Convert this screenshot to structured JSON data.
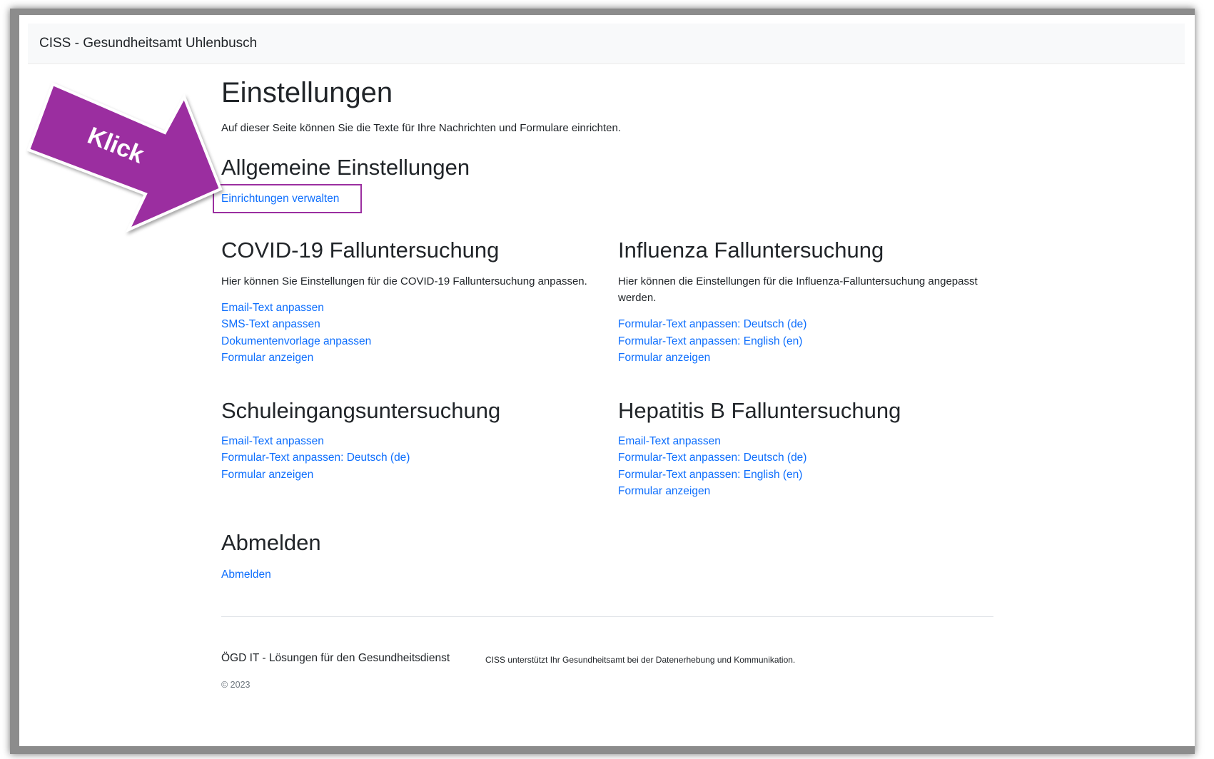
{
  "app": {
    "brand": "CISS - Gesundheitsamt Uhlenbusch"
  },
  "page": {
    "title": "Einstellungen",
    "intro": "Auf dieser Seite können Sie die Texte für Ihre Nachrichten und Formulare einrichten."
  },
  "general": {
    "heading": "Allgemeine Einstellungen",
    "link": "Einrichtungen verwalten"
  },
  "covid": {
    "heading": "COVID-19 Falluntersuchung",
    "description": "Hier können Sie Einstellungen für die COVID-19 Falluntersuchung anpassen.",
    "links": [
      "Email-Text anpassen",
      "SMS-Text anpassen",
      "Dokumentenvorlage anpassen",
      "Formular anzeigen"
    ]
  },
  "influenza": {
    "heading": "Influenza Falluntersuchung",
    "description": "Hier können die Einstellungen für die Influenza-Falluntersuchung angepasst werden.",
    "links": [
      "Formular-Text anpassen: Deutsch (de)",
      "Formular-Text anpassen: English (en)",
      "Formular anzeigen"
    ]
  },
  "school": {
    "heading": "Schuleingangsuntersuchung",
    "links": [
      "Email-Text anpassen",
      "Formular-Text anpassen: Deutsch (de)",
      "Formular anzeigen"
    ]
  },
  "hepatitis": {
    "heading": "Hepatitis B Falluntersuchung",
    "links": [
      "Email-Text anpassen",
      "Formular-Text anpassen: Deutsch (de)",
      "Formular-Text anpassen: English (en)",
      "Formular anzeigen"
    ]
  },
  "logout": {
    "heading": "Abmelden",
    "link": "Abmelden"
  },
  "footer": {
    "brand": "ÖGD IT - Lösungen für den Gesundheitsdienst",
    "note": "CISS unterstützt Ihr Gesundheitsamt bei der Datenerhebung und Kommunikation.",
    "copyright": "© 2023"
  },
  "annotation": {
    "label": "Klick",
    "color": "#9b2fa0"
  }
}
